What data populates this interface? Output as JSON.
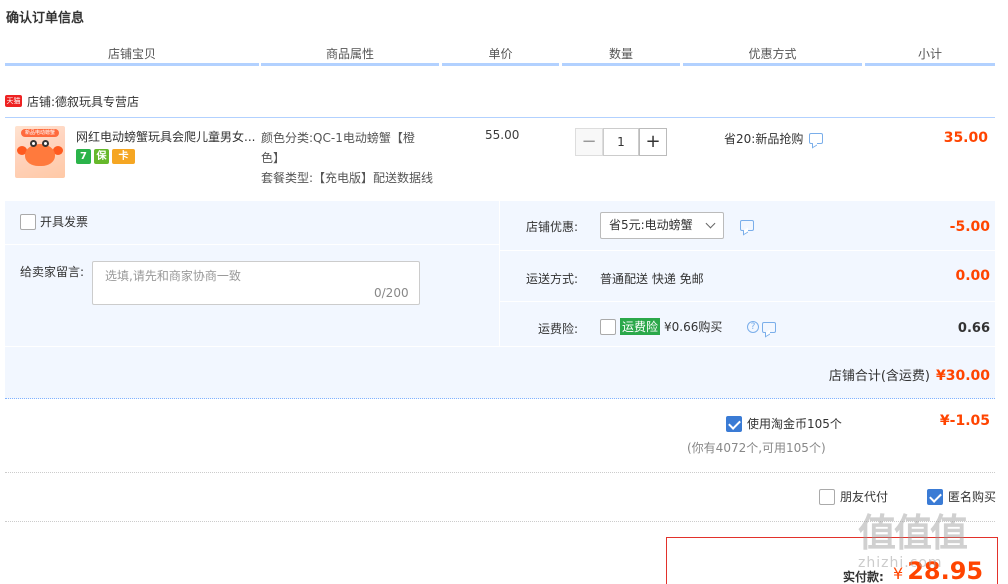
{
  "page_title": "确认订单信息",
  "columns": [
    "店铺宝贝",
    "商品属性",
    "单价",
    "数量",
    "优惠方式",
    "小计"
  ],
  "shop": {
    "badge": "天猫",
    "label": "店铺:德叙玩具专营店"
  },
  "item": {
    "thumb_tag": "新品电动螃蟹",
    "name": "网红电动螃蟹玩具会爬儿童男女...",
    "service_icons": [
      "7",
      "保",
      "卡"
    ],
    "attr_line1": "颜色分类:QC-1电动螃蟹【橙",
    "attr_line2": "色】",
    "attr_line3": "套餐类型:【充电版】配送数据线",
    "unit_price": "55.00",
    "quantity": "1",
    "qty_minus": "−",
    "qty_plus": "+",
    "promo": "省20:新品抢购",
    "subtotal": "35.00"
  },
  "invoice_label": "开具发票",
  "memo": {
    "label": "给卖家留言:",
    "placeholder": "选填,请先和商家协商一致",
    "count": "0/200"
  },
  "shop_discount": {
    "label": "店铺优惠:",
    "selected": "省5元:电动螃蟹",
    "amount": "-5.00"
  },
  "shipping": {
    "label": "运送方式:",
    "value": "普通配送 快递 免邮",
    "amount": "0.00"
  },
  "insurance": {
    "label": "运费险:",
    "badge": "运费险",
    "value": "¥0.66购买",
    "amount": "0.66"
  },
  "shop_total": {
    "label": "店铺合计(含运费)",
    "amount": "¥30.00"
  },
  "coins": {
    "label": "使用淘金币105个",
    "note": "(你有4072个,可用105个)",
    "amount": "¥-1.05"
  },
  "friend_pay": "朋友代付",
  "anonymous": "匿名购买",
  "payment": {
    "label": "实付款:",
    "currency": "¥",
    "amount": "28.95"
  },
  "watermark": {
    "chars": "值值值",
    "url": "zhizhi.com"
  }
}
